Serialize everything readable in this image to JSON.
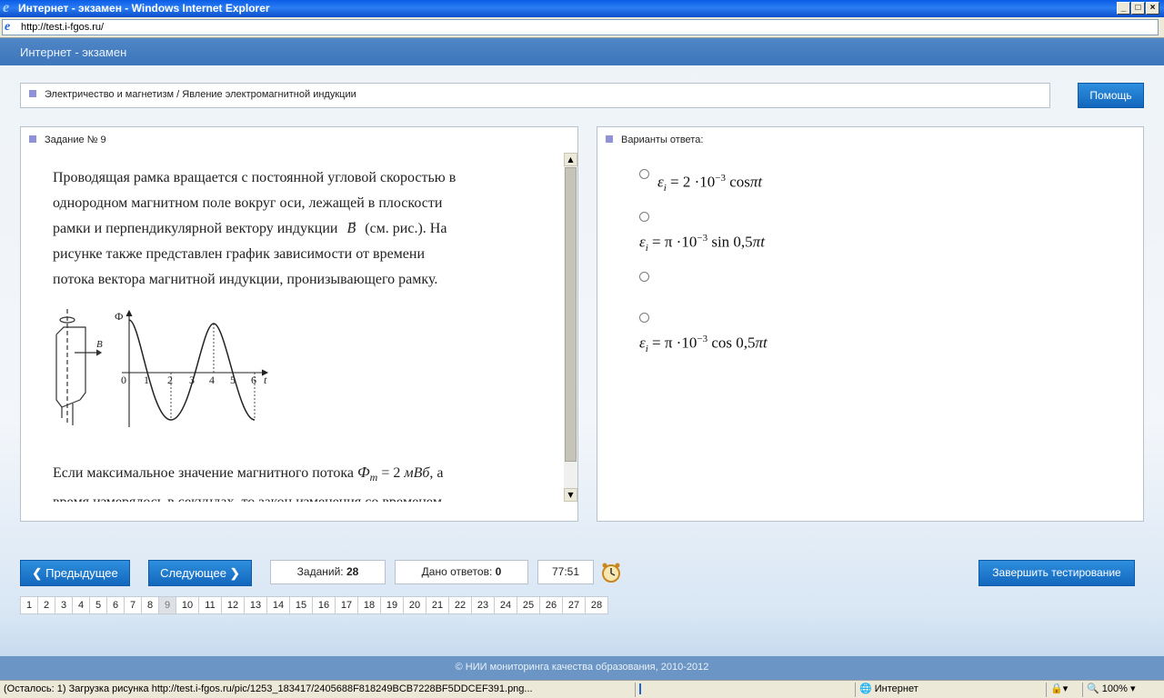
{
  "window": {
    "title": "Интернет - экзамен - Windows Internet Explorer",
    "minimize_label": "_",
    "maximize_label": "□",
    "close_label": "×",
    "address": "http://test.i-fgos.ru/"
  },
  "site": {
    "header_title": "Интернет - экзамен",
    "breadcrumb": "Электричество и магнетизм / Явление электромагнитной индукции",
    "help_label": "Помощь",
    "footer": "© НИИ мониторинга качества образования, 2010-2012"
  },
  "task": {
    "heading": "Задание № 9",
    "text_lines": [
      "Проводящая рамка вращается с постоянной угловой скоростью в",
      "однородном магнитном поле вокруг оси, лежащей в плоскости",
      "рамки и перпендикулярной вектору индукции",
      "(см. рис.). На",
      "рисунке также представлен график зависимости от времени",
      "потока вектора магнитной индукции, пронизывающего рамку."
    ],
    "vector_symbol": "B",
    "text2_line1_start": "Если максимальное значение магнитного потока",
    "flux_symbol": "Ф",
    "flux_sub": "m",
    "flux_value": "= 2",
    "flux_unit": "мВб",
    "text2_line1_end": ", а",
    "text2_line2": "время измерялось в секундах, то закон изменения со временем",
    "figure": {
      "phi_label": "Ф",
      "t_label": "t",
      "b_label": "B",
      "ticks": [
        "0",
        "1",
        "2",
        "3",
        "4",
        "5",
        "6"
      ]
    }
  },
  "answers": {
    "heading": "Варианты ответа:",
    "options": [
      {
        "eps": "ε",
        "sub": "i",
        "rhs_pre": "= 2 ·10",
        "exp": "−3",
        "func": "cos",
        "arg": "πt"
      },
      {
        "eps": "ε",
        "sub": "i",
        "rhs_pre": "= π ·10",
        "exp": "−3",
        "func": "sin 0,5",
        "arg": "πt"
      },
      {
        "empty": true
      },
      {
        "eps": "ε",
        "sub": "i",
        "rhs_pre": "= π ·10",
        "exp": "−3",
        "func": "cos 0,5",
        "arg": "πt"
      }
    ]
  },
  "navigation": {
    "prev_label": "Предыдущее",
    "next_label": "Следующее",
    "tasks_label": "Заданий:",
    "tasks_count": "28",
    "answers_label": "Дано ответов:",
    "answers_count": "0",
    "timer": "77:51",
    "finish_label": "Завершить тестирование",
    "pages": [
      "1",
      "2",
      "3",
      "4",
      "5",
      "6",
      "7",
      "8",
      "9",
      "10",
      "11",
      "12",
      "13",
      "14",
      "15",
      "16",
      "17",
      "18",
      "19",
      "20",
      "21",
      "22",
      "23",
      "24",
      "25",
      "26",
      "27",
      "28"
    ],
    "current_page": "9"
  },
  "statusbar": {
    "loading": "(Осталось: 1) Загрузка рисунка http://test.i-fgos.ru/pic/1253_183417/2405688F818249BCB7228BF5DDCEF391.png...",
    "zone": "Интернет",
    "zoom": "100%"
  }
}
